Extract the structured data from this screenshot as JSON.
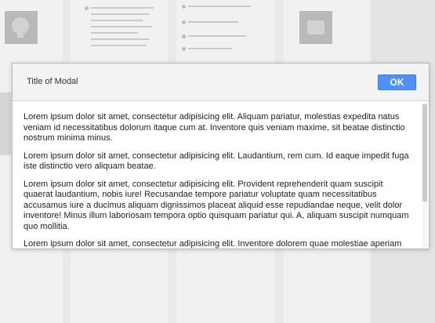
{
  "modal": {
    "title": "Title of Modal",
    "ok_label": "OK",
    "paragraphs": [
      "Lorem ipsum dolor sit amet, consectetur adipisicing elit. Aliquam pariatur, molestias expedita natus veniam id necessitatibus dolorum itaque cum at. Inventore quis veniam maxime, sit beatae distinctio nostrum minima minus.",
      "Lorem ipsum dolor sit amet, consectetur adipisicing elit. Laudantium, rem cum. Id eaque impedit fuga iste distinctio vero aliquam beatae.",
      "Lorem ipsum dolor sit amet, consectetur adipisicing elit. Provident reprehenderit quam suscipit quaerat laudantium, nobis iure! Recusandae tempore pariatur voluptate quam necessitatibus accusamus iure a ducimus aliquam dignissimos placeat aliquid esse repudiandae neque, velit dolor inventore! Minus illum laboriosam tempora optio quisquam pariatur qui. A, aliquam suscipit numquam quo mollitia.",
      "Lorem ipsum dolor sit amet, consectetur adipisicing elit. Inventore dolorem quae molestiae aperiam at, nobis."
    ]
  },
  "background": {
    "icons": [
      "map-pin-icon",
      "chat-bubble-icon"
    ]
  },
  "colors": {
    "accent": "#4d90fe",
    "header_bg": "#f3f3f3",
    "backdrop": "#e9e9e9"
  }
}
